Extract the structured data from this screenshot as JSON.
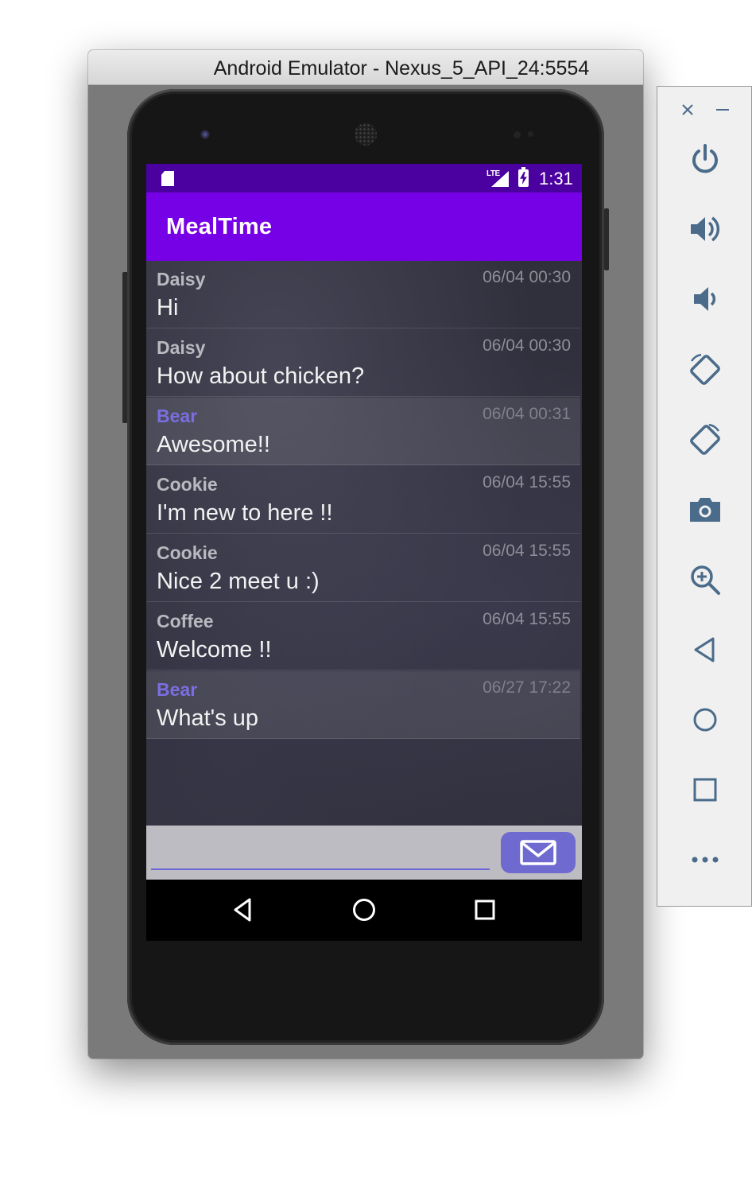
{
  "window": {
    "title": "Android Emulator - Nexus_5_API_24:5554"
  },
  "status_bar": {
    "time": "1:31",
    "network": "LTE"
  },
  "app": {
    "title": "MealTime"
  },
  "messages": [
    {
      "sender": "Daisy",
      "time": "06/04 00:30",
      "text": "Hi",
      "self": false
    },
    {
      "sender": "Daisy",
      "time": "06/04 00:30",
      "text": "How about chicken?",
      "self": false
    },
    {
      "sender": "Bear",
      "time": "06/04 00:31",
      "text": "Awesome!!",
      "self": true
    },
    {
      "sender": "Cookie",
      "time": "06/04 15:55",
      "text": "I'm new to here !!",
      "self": false
    },
    {
      "sender": "Cookie",
      "time": "06/04 15:55",
      "text": "Nice 2 meet u :)",
      "self": false
    },
    {
      "sender": "Coffee",
      "time": "06/04 15:55",
      "text": "Welcome !!",
      "self": false
    },
    {
      "sender": "Bear",
      "time": "06/27 17:22",
      "text": "What's up",
      "self": true
    }
  ],
  "composer": {
    "value": "",
    "placeholder": ""
  },
  "colors": {
    "status_bar": "#4b00a0",
    "app_bar": "#7600e6",
    "self_name": "#7b6ee0",
    "send_button": "#6f6ad0"
  },
  "icons": {
    "status": [
      "sd-card-icon",
      "lte-signal-icon",
      "battery-charging-icon"
    ],
    "nav": [
      "back-icon",
      "home-icon",
      "recents-icon"
    ],
    "send": "mail-icon",
    "toolbar": [
      "close-icon",
      "minimize-icon",
      "power-icon",
      "volume-up-icon",
      "volume-down-icon",
      "rotate-left-icon",
      "rotate-right-icon",
      "camera-icon",
      "zoom-icon",
      "back-icon",
      "home-icon",
      "overview-icon",
      "more-icon"
    ]
  }
}
